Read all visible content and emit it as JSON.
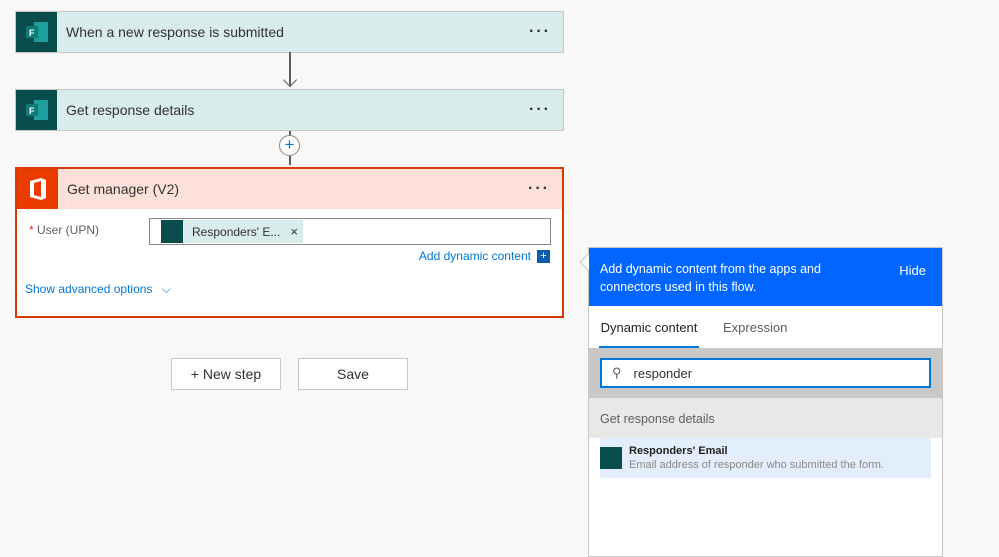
{
  "steps": [
    {
      "title": "When a new response is submitted",
      "icon": "forms-icon"
    },
    {
      "title": "Get response details",
      "icon": "forms-icon"
    }
  ],
  "manager": {
    "title": "Get manager (V2)",
    "icon": "office-icon",
    "field_label": "User (UPN)",
    "required_mark": "*",
    "token": "Responders' E...",
    "token_remove": "×",
    "add_dynamic": "Add dynamic content",
    "add_dynamic_icon": "+",
    "advanced": "Show advanced options"
  },
  "more": "···",
  "buttons": {
    "new_step": "+ New step",
    "save": "Save"
  },
  "panel": {
    "header": "Add dynamic content from the apps and connectors used in this flow.",
    "hide": "Hide",
    "tabs": [
      "Dynamic content",
      "Expression"
    ],
    "search_value": "responder",
    "section": "Get response details",
    "item": {
      "title": "Responders' Email",
      "desc": "Email address of responder who submitted the form."
    }
  },
  "colors": {
    "accent": "#0078d4",
    "panel_blue": "#0066ff",
    "error_border": "#d83b01",
    "forms": "#084c4c"
  }
}
